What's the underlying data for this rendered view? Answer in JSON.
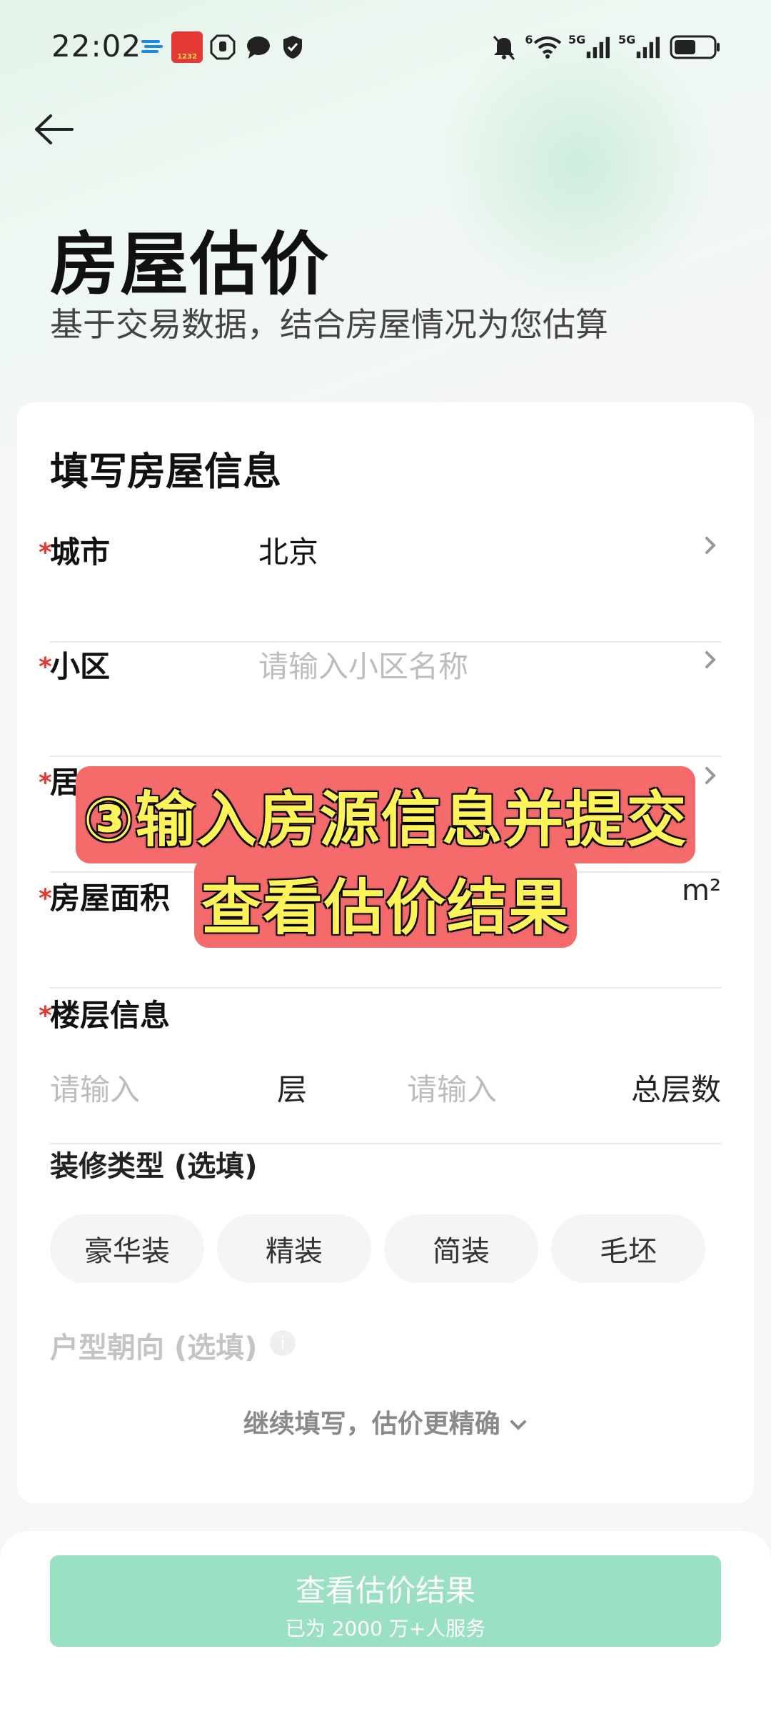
{
  "status_bar": {
    "time": "22:02",
    "left_icons": [
      "weather-icon",
      "app-badge-icon",
      "hand-icon",
      "chat-icon",
      "shield-icon"
    ],
    "right_icons": [
      "mute-icon",
      "wifi-icon",
      "signal-5g-1-icon",
      "signal-5g-2-icon",
      "battery-icon"
    ],
    "badge_text": "1232",
    "wifi_label": "6",
    "signal_1_label": "5G",
    "signal_2_label": "5G",
    "battery_level": 0.55
  },
  "header": {
    "title": "房屋估价",
    "subtitle": "基于交易数据，结合房屋情况为您估算"
  },
  "form": {
    "title": "填写房屋信息",
    "required_mark": "*",
    "city": {
      "label": "城市",
      "value": "北京"
    },
    "community": {
      "label": "小区",
      "placeholder": "请输入小区名称"
    },
    "layout": {
      "label": "居室"
    },
    "area": {
      "label": "房屋面积",
      "unit": "m²"
    },
    "floor": {
      "label": "楼层信息",
      "floor_placeholder": "请输入",
      "floor_unit": "层",
      "total_placeholder": "请输入",
      "total_unit": "总层数"
    },
    "decoration": {
      "label": "装修类型 (选填)",
      "options": [
        "豪华装",
        "精装",
        "简装",
        "毛坯"
      ]
    },
    "orientation": {
      "label": "户型朝向 (选填)"
    },
    "more_link": "继续填写，估价更精确"
  },
  "submit": {
    "label": "查看估价结果",
    "sub_label": "已为 2000 万+人服务"
  },
  "overlay": {
    "line1": "③输入房源信息并提交",
    "line2": "查看估价结果"
  },
  "colors": {
    "accent_disabled": "#9ae0c2",
    "required": "#e53935",
    "overlay_bg": "#f56a6a",
    "overlay_text": "#fff35a"
  }
}
